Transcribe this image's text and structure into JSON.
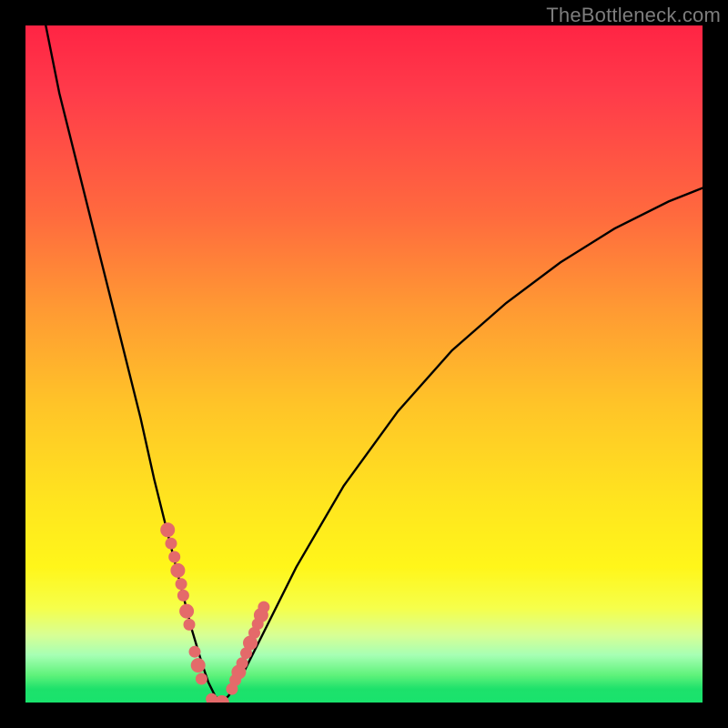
{
  "watermark": "TheBottleneck.com",
  "colors": {
    "background_frame": "#000000",
    "gradient_top": "#ff2444",
    "gradient_mid": "#ffe41f",
    "gradient_bottom": "#19e36d",
    "curve": "#000000",
    "dots": "#e46a6a",
    "watermark_text": "#7d7d7d"
  },
  "chart_data": {
    "type": "line",
    "title": "",
    "xlabel": "",
    "ylabel": "",
    "xlim": [
      0,
      100
    ],
    "ylim": [
      0,
      100
    ],
    "series": [
      {
        "name": "bottleneck-curve",
        "x": [
          3,
          5,
          8,
          11,
          14,
          17,
          19,
          21,
          23,
          24.5,
          26,
          27,
          28,
          29,
          30,
          32,
          35,
          40,
          47,
          55,
          63,
          71,
          79,
          87,
          95,
          100
        ],
        "y": [
          100,
          90,
          78,
          66,
          54,
          42,
          33,
          25,
          17,
          11,
          6,
          3,
          1,
          0,
          1,
          4,
          10,
          20,
          32,
          43,
          52,
          59,
          65,
          70,
          74,
          76
        ]
      }
    ],
    "highlight_points": {
      "name": "highlighted-dots",
      "x": [
        21.0,
        21.5,
        22.0,
        22.5,
        23.0,
        23.3,
        23.8,
        24.2,
        25.0,
        25.5,
        26.0,
        27.5,
        29.0,
        30.5,
        31.0,
        31.5,
        32.0,
        32.6,
        33.2,
        33.8,
        34.3,
        34.8,
        35.2
      ],
      "y": [
        25.5,
        23.5,
        21.5,
        19.5,
        17.5,
        15.8,
        13.5,
        11.5,
        7.5,
        5.5,
        3.5,
        0.5,
        0.0,
        2.0,
        3.3,
        4.5,
        5.8,
        7.3,
        8.8,
        10.3,
        11.6,
        12.9,
        14.1
      ]
    }
  }
}
